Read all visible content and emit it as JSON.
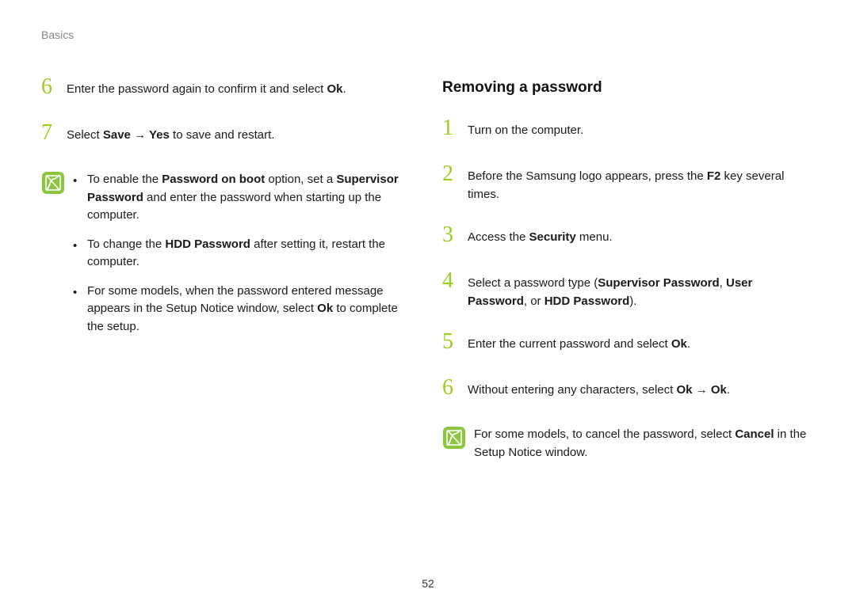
{
  "header": {
    "section": "Basics"
  },
  "left": {
    "step6": {
      "num": "6",
      "t1": "Enter the password again to confirm it and select ",
      "b1": "Ok",
      "t2": "."
    },
    "step7": {
      "num": "7",
      "t1": "Select ",
      "b1": "Save",
      "arrow": " → ",
      "b2": "Yes",
      "t2": " to save and restart."
    },
    "note": {
      "b1": {
        "t1": "To enable the ",
        "bold1": "Password on boot",
        "t2": " option, set a ",
        "bold2": "Supervisor Password",
        "t3": " and enter the password when starting up the computer."
      },
      "b2": {
        "t1": "To change the ",
        "bold1": "HDD Password",
        "t2": " after setting it, restart the computer."
      },
      "b3": {
        "t1": "For some models, when the password entered message appears in the Setup Notice window, select ",
        "bold1": "Ok",
        "t2": " to complete the setup."
      }
    }
  },
  "right": {
    "title": "Removing a password",
    "s1": {
      "num": "1",
      "t1": "Turn on the computer."
    },
    "s2": {
      "num": "2",
      "t1": "Before the Samsung logo appears, press the ",
      "b1": "F2",
      "t2": " key several times."
    },
    "s3": {
      "num": "3",
      "t1": "Access the ",
      "b1": "Security",
      "t2": " menu."
    },
    "s4": {
      "num": "4",
      "t1": "Select a password type (",
      "b1": "Supervisor Password",
      "t2": ", ",
      "b2": "User Password",
      "t3": ", or ",
      "b3": "HDD Password",
      "t4": ")."
    },
    "s5": {
      "num": "5",
      "t1": "Enter the current password and select ",
      "b1": "Ok",
      "t2": "."
    },
    "s6": {
      "num": "6",
      "t1": "Without entering any characters, select ",
      "b1": "Ok",
      "arrow": " → ",
      "b2": "Ok",
      "t2": "."
    },
    "note": {
      "t1": "For some models, to cancel the password, select ",
      "b1": "Cancel",
      "t2": " in the Setup Notice window."
    }
  },
  "page": "52"
}
